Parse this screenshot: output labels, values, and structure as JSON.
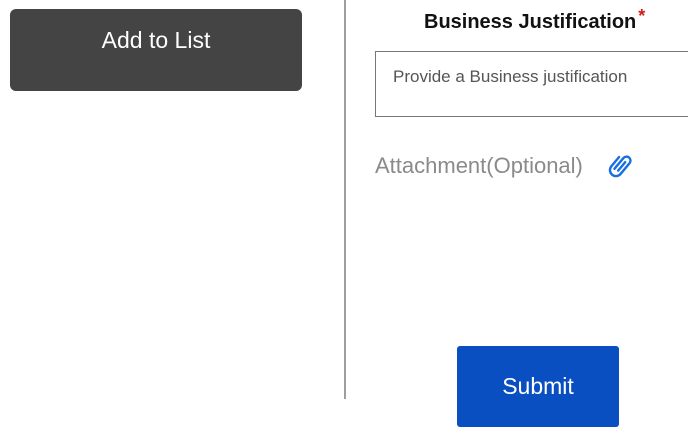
{
  "left_panel": {
    "add_to_list_label": "Add to List"
  },
  "form": {
    "justification_label": "Business Justification",
    "required_marker": "*",
    "justification_placeholder": "Provide a Business justification",
    "justification_value": "",
    "attachment_label": "Attachment(Optional)",
    "attachment_icon": "paperclip-icon",
    "submit_label": "Submit"
  },
  "colors": {
    "add_button_bg": "#444444",
    "submit_button_bg": "#0a4fc2",
    "required_star": "#d11a1a",
    "attachment_icon": "#1a6fe0"
  }
}
